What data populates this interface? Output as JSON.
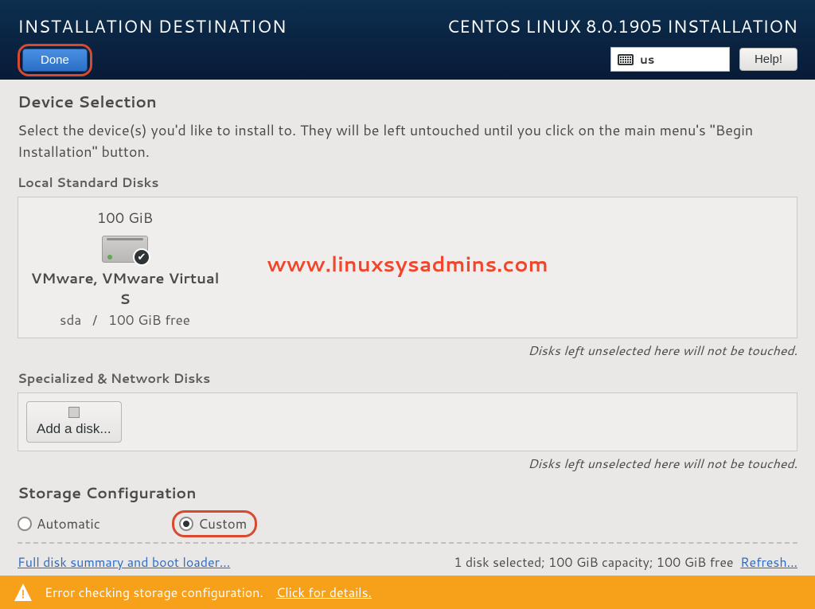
{
  "header": {
    "title": "INSTALLATION DESTINATION",
    "done_label": "Done",
    "product": "CENTOS LINUX 8.0.1905 INSTALLATION",
    "keyboard_layout": "us",
    "help_label": "Help!"
  },
  "device_selection": {
    "heading": "Device Selection",
    "intro": "Select the device(s) you'd like to install to.  They will be left untouched until you click on the main menu's \"Begin Installation\" button."
  },
  "local_disks": {
    "heading": "Local Standard Disks",
    "note": "Disks left unselected here will not be touched.",
    "items": [
      {
        "size": "100 GiB",
        "name": "VMware, VMware Virtual S",
        "dev": "sda",
        "sep": "/",
        "free": "100 GiB free",
        "selected": true
      }
    ]
  },
  "specialized": {
    "heading": "Specialized & Network Disks",
    "add_label": "Add a disk...",
    "note": "Disks left unselected here will not be touched."
  },
  "storage_config": {
    "heading": "Storage Configuration",
    "automatic_label": "Automatic",
    "custom_label": "Custom",
    "selected": "Custom"
  },
  "footer": {
    "summary_link": "Full disk summary and boot loader...",
    "status": "1 disk selected; 100 GiB capacity; 100 GiB free",
    "refresh_label": "Refresh..."
  },
  "error_bar": {
    "message": "Error checking storage configuration.",
    "details_link": "Click for details."
  },
  "watermark": "www.linuxsysadmins.com"
}
